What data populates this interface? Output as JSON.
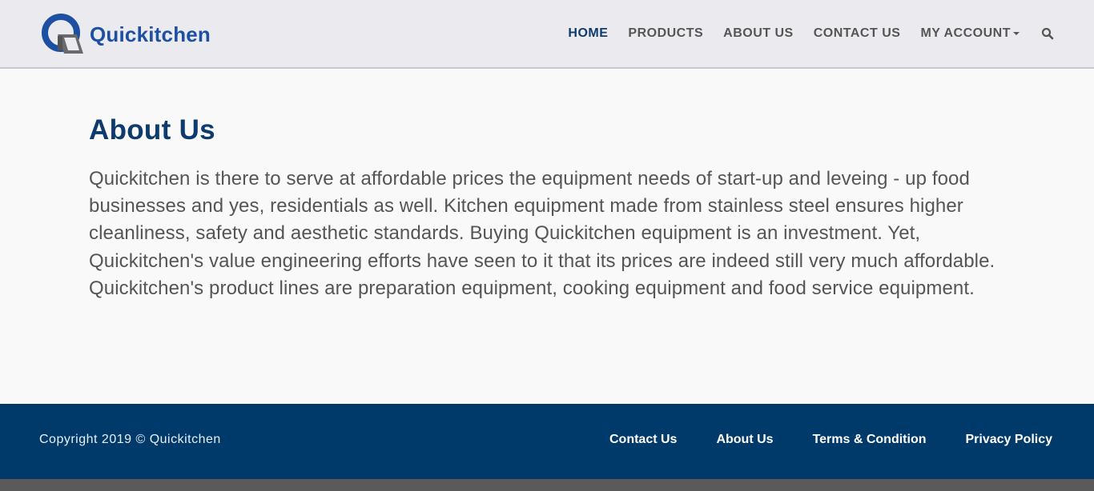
{
  "brand": {
    "name": "Quickitchen",
    "logo_icon": "quickitchen-q-logo"
  },
  "nav": {
    "items": [
      {
        "label": "HOME",
        "active": true
      },
      {
        "label": "PRODUCTS"
      },
      {
        "label": "ABOUT US"
      },
      {
        "label": "CONTACT US"
      },
      {
        "label": "MY ACCOUNT",
        "has_dropdown": true
      }
    ],
    "search_icon": "search-icon"
  },
  "main": {
    "title": "About Us",
    "body": "Quickitchen is there to serve at affordable prices the equipment needs of start-up and leveing - up food businesses and yes, residentials as well. Kitchen equipment made from stainless steel ensures higher cleanliness, safety and aesthetic standards. Buying Quickitchen equipment is an investment. Yet, Quickitchen's value engineering efforts have seen to it that its prices are indeed still very much affordable. Quickitchen's product lines are preparation equipment, cooking equipment and food service equipment."
  },
  "footer": {
    "copyright": "Copyright 2019 © Quickitchen",
    "links": [
      "Contact Us",
      "About Us",
      "Terms & Condition",
      "Privacy Policy"
    ]
  },
  "colors": {
    "brand_blue": "#1d4fa3",
    "navy": "#003a6b",
    "heading": "#0d3b6e",
    "nav_gray": "#555555",
    "header_bg": "#ebebef"
  }
}
